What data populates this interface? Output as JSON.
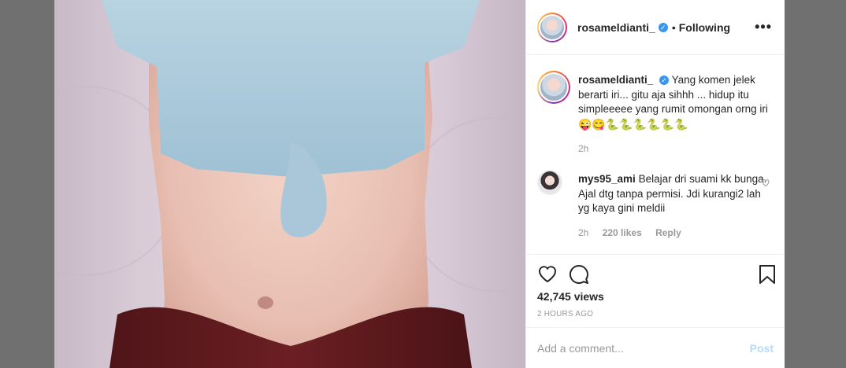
{
  "header": {
    "username": "rosameldianti_",
    "separator": "•",
    "follow_status": "Following",
    "more_label": "•••"
  },
  "caption": {
    "username": "rosameldianti_",
    "text": "Yang komen jelek berarti iri... gitu aja sihhh ... hidup itu simpleeeee yang rumit omongan orng iri",
    "emojis": "😜😋🐍🐍🐍🐍🐍🐍",
    "time": "2h"
  },
  "comments": [
    {
      "username": "mys95_ami",
      "text": "Belajar dri suami kk bunga. Ajal dtg tanpa permisi. Jdi kurangi2 lah yg kaya gini meldii",
      "time": "2h",
      "likes": "220 likes",
      "reply_label": "Reply"
    }
  ],
  "stats": {
    "views": "42,745 views",
    "posted": "2 HOURS AGO"
  },
  "add_comment": {
    "placeholder": "Add a comment...",
    "post_label": "Post"
  },
  "colors": {
    "accent": "#3897f0",
    "post_disabled": "#b3dbff",
    "muted": "#999999",
    "text": "#262626"
  },
  "icons": [
    "verified-badge-icon",
    "more-options-icon",
    "heart-icon",
    "comment-icon",
    "bookmark-icon",
    "small-heart-icon"
  ]
}
